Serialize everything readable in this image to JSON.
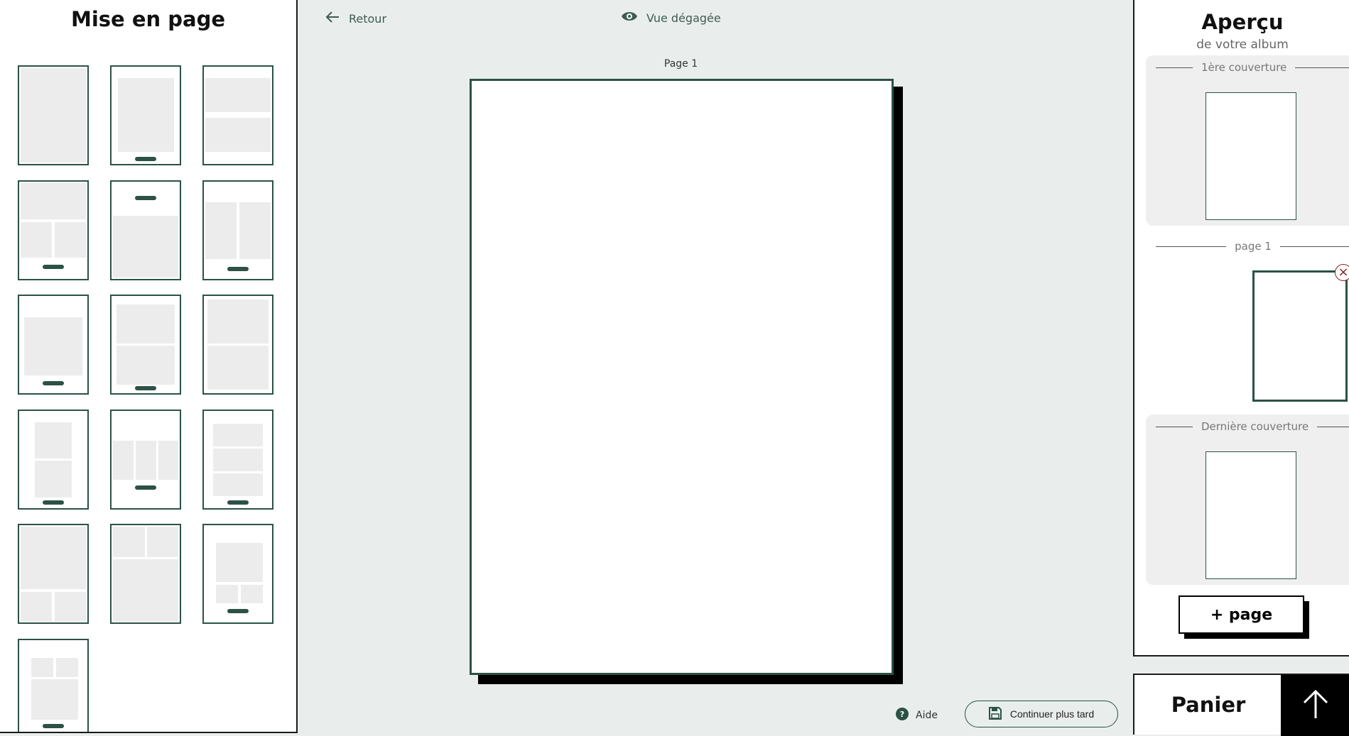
{
  "left_panel": {
    "title": "Mise en page",
    "layouts": [
      {
        "name": "full-page"
      },
      {
        "name": "single-photo-caption"
      },
      {
        "name": "two-horizontal"
      },
      {
        "name": "one-top-two-bottom-caption"
      },
      {
        "name": "caption-top-single"
      },
      {
        "name": "two-vertical-caption"
      },
      {
        "name": "single-photo-caption-large"
      },
      {
        "name": "two-stacked-caption"
      },
      {
        "name": "two-stacked-full"
      },
      {
        "name": "two-stacked-narrow-caption"
      },
      {
        "name": "three-columns-caption"
      },
      {
        "name": "three-stacked-caption"
      },
      {
        "name": "one-top-two-bottom"
      },
      {
        "name": "two-top-one-bottom"
      },
      {
        "name": "one-top-two-bottom-small-caption"
      },
      {
        "name": "two-top-one-bottom-small-caption"
      }
    ]
  },
  "toolbar": {
    "back_label": "Retour",
    "clean_view_label": "Vue dégagée"
  },
  "canvas": {
    "page_label": "Page 1"
  },
  "footer": {
    "help_label": "Aide",
    "save_later_label": "Continuer plus tard"
  },
  "preview": {
    "title": "Aperçu",
    "subtitle": "de votre album",
    "front_cover_label": "1ère couverture",
    "page_label": "page 1",
    "back_cover_label": "Dernière couverture",
    "add_page_label": "+ page",
    "delete_icon": "close-circle-icon"
  },
  "cart": {
    "label": "Panier",
    "toggle_icon": "arrow-up-icon"
  },
  "colors": {
    "accent": "#2b5244",
    "background": "#e9eeec",
    "placeholder": "#ececec",
    "delete": "#8a2020"
  }
}
